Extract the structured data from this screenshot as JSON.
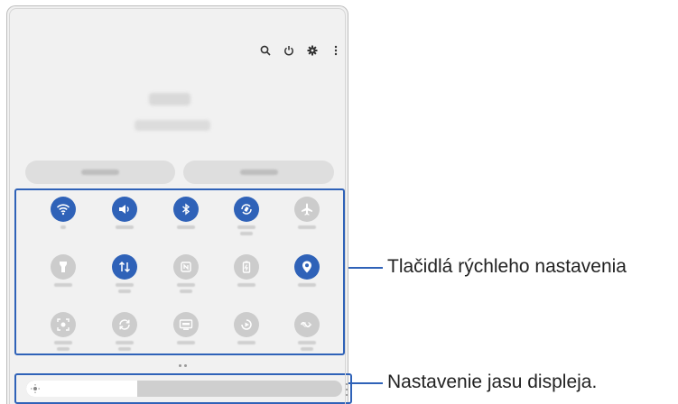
{
  "callouts": {
    "quick_settings": "Tlačidlá rýchleho nastavenia",
    "brightness": "Nastavenie jasu displeja."
  },
  "header_actions": [
    "search-icon",
    "power-icon",
    "gear-icon",
    "more-vert-icon"
  ],
  "quick_settings": [
    {
      "icon": "wifi-icon",
      "state": "on"
    },
    {
      "icon": "sound-icon",
      "state": "on"
    },
    {
      "icon": "bluetooth-icon",
      "state": "on"
    },
    {
      "icon": "auto-rotate-icon",
      "state": "on"
    },
    {
      "icon": "airplane-icon",
      "state": "off"
    },
    {
      "icon": "flashlight-icon",
      "state": "off"
    },
    {
      "icon": "mobile-data-icon",
      "state": "on"
    },
    {
      "icon": "nfc-icon",
      "state": "off"
    },
    {
      "icon": "power-saving-icon",
      "state": "off"
    },
    {
      "icon": "location-icon",
      "state": "on"
    },
    {
      "icon": "screen-recorder-icon",
      "state": "off"
    },
    {
      "icon": "sync-icon",
      "state": "off"
    },
    {
      "icon": "dex-icon",
      "state": "off"
    },
    {
      "icon": "smart-view-icon",
      "state": "off"
    },
    {
      "icon": "nearby-share-icon",
      "state": "off"
    }
  ],
  "brightness": {
    "level": 0.35
  },
  "colors": {
    "accent": "#2f62b8",
    "tile_off": "#cccccc",
    "panel": "#f1f1f1"
  }
}
